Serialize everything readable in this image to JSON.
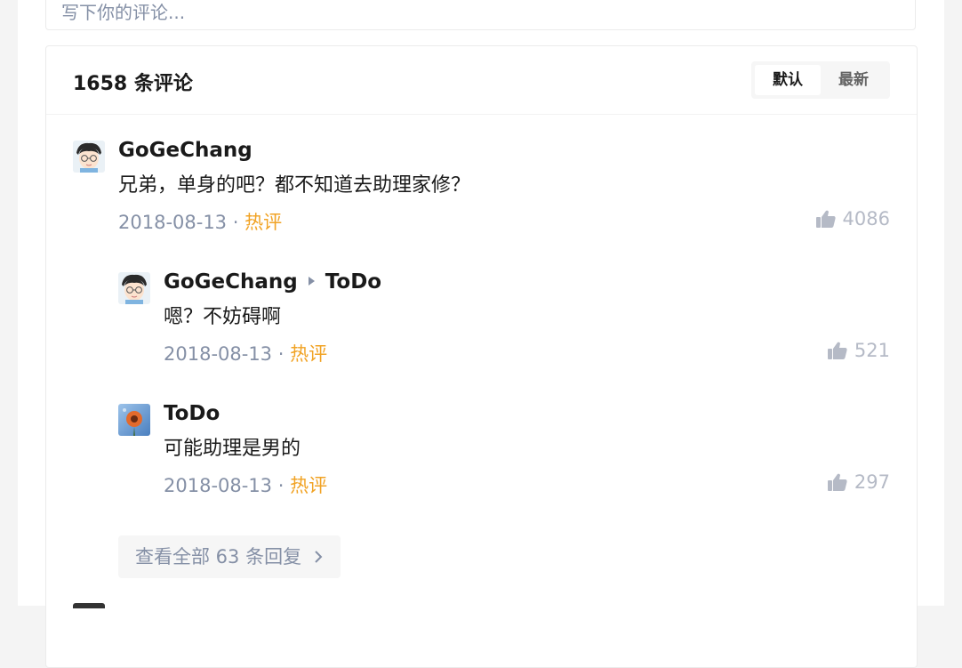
{
  "editor": {
    "placeholder": "写下你的评论..."
  },
  "comments_header": {
    "count_label": "1658 条评论",
    "sort_options": [
      {
        "label": "默认",
        "active": true
      },
      {
        "label": "最新",
        "active": false
      }
    ]
  },
  "comments": [
    {
      "author": "GoGeChang",
      "reply_to": null,
      "text": "兄弟，单身的吧？都不知道去助理家修？",
      "date": "2018-08-13",
      "separator": " · ",
      "tag": "热评",
      "likes": "4086",
      "avatar_icon": "cartoon-avatar-icon"
    },
    {
      "author": "GoGeChang",
      "reply_to": "ToDo",
      "text": "嗯？不妨碍啊",
      "date": "2018-08-13",
      "separator": " · ",
      "tag": "热评",
      "likes": "521",
      "avatar_icon": "cartoon-avatar-icon"
    },
    {
      "author": "ToDo",
      "reply_to": null,
      "text": "可能助理是男的",
      "date": "2018-08-13",
      "separator": " · ",
      "tag": "热评",
      "likes": "297",
      "avatar_icon": "flower-avatar-icon"
    }
  ],
  "view_all": {
    "label": "查看全部 63 条回复",
    "icon": "chevron-right-icon"
  },
  "colors": {
    "hot_tag": "#f1a325",
    "meta_text": "#8590a6",
    "like_icon": "#b5bac6"
  }
}
